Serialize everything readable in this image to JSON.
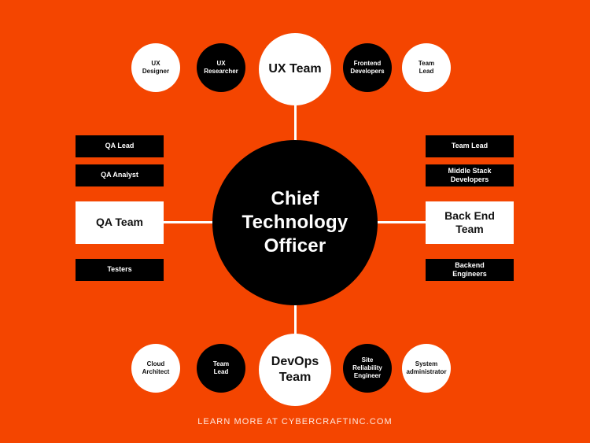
{
  "theme": {
    "background": "#F44500",
    "black": "#000000",
    "white": "#FFFFFF",
    "connector": "#FFFFFF",
    "footer_text_color": "#FFE9E0"
  },
  "hub": {
    "label": "Chief Technology Officer",
    "line1": "Chief",
    "line2": "Technology",
    "line3": "Officer"
  },
  "top_branch": {
    "lead": {
      "label": "UX Team",
      "shape": "circle",
      "style": "white"
    },
    "members": [
      {
        "label": "UX Designer",
        "line1": "UX",
        "line2": "Designer",
        "shape": "circle",
        "style": "white"
      },
      {
        "label": "UX Researcher",
        "line1": "UX",
        "line2": "Researcher",
        "shape": "circle",
        "style": "black"
      },
      {
        "label": "Frontend Developers",
        "line1": "Frontend",
        "line2": "Developers",
        "shape": "circle",
        "style": "black"
      },
      {
        "label": "Team Lead",
        "line1": "Team",
        "line2": "Lead",
        "shape": "circle",
        "style": "white"
      }
    ]
  },
  "left_branch": {
    "lead": {
      "label": "QA Team",
      "shape": "box",
      "style": "white"
    },
    "members": [
      {
        "label": "QA Lead",
        "shape": "box",
        "style": "black"
      },
      {
        "label": "QA Analyst",
        "shape": "box",
        "style": "black"
      },
      {
        "label": "Testers",
        "shape": "box",
        "style": "black"
      }
    ]
  },
  "right_branch": {
    "lead": {
      "label": "Back End Team",
      "line1": "Back End",
      "line2": "Team",
      "shape": "box",
      "style": "white"
    },
    "members": [
      {
        "label": "Team Lead",
        "line1": "Team Lead",
        "line2": "",
        "shape": "box",
        "style": "black"
      },
      {
        "label": "Middle Stack Developers",
        "line1": "Middle Stack",
        "line2": "Developers",
        "shape": "box",
        "style": "black"
      },
      {
        "label": "Backend Engineers",
        "line1": "Backend",
        "line2": "Engineers",
        "shape": "box",
        "style": "black"
      }
    ]
  },
  "bottom_branch": {
    "lead": {
      "label": "DevOps Team",
      "line1": "DevOps",
      "line2": "Team",
      "shape": "circle",
      "style": "white"
    },
    "members": [
      {
        "label": "Cloud Architect",
        "line1": "Cloud",
        "line2": "Architect",
        "line3": "",
        "shape": "circle",
        "style": "white"
      },
      {
        "label": "Team Lead",
        "line1": "Team",
        "line2": "Lead",
        "line3": "",
        "shape": "circle",
        "style": "black"
      },
      {
        "label": "Site Reliability Engineer",
        "line1": "Site",
        "line2": "Reliability",
        "line3": "Engineer",
        "shape": "circle",
        "style": "black"
      },
      {
        "label": "System administrator",
        "line1": "System",
        "line2": "administrator",
        "line3": "",
        "shape": "circle",
        "style": "white"
      }
    ]
  },
  "footer": {
    "text": "LEARN MORE AT CYBERCRAFTINC.COM"
  }
}
